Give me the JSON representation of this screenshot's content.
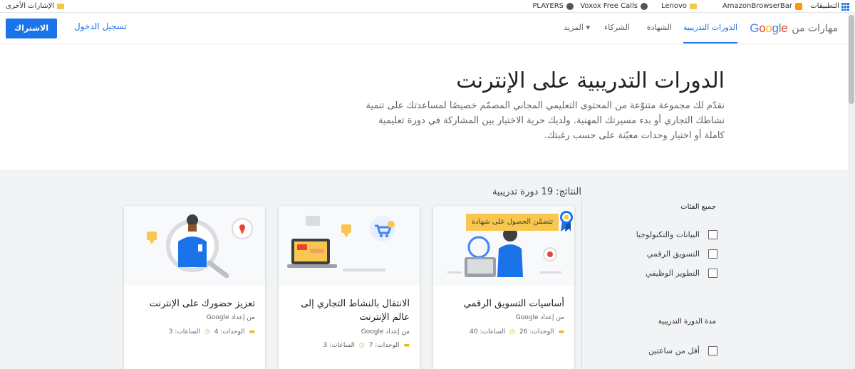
{
  "bookmarks": {
    "left": [
      {
        "label": "الإشارات الأخرى",
        "icon": "folder-icon"
      }
    ],
    "right": [
      {
        "label": "التطبيقات",
        "icon": "apps-icon"
      },
      {
        "label": "AmazonBrowserBar",
        "icon": "amazon-icon"
      },
      {
        "label": "Lenovo",
        "icon": "folder-icon"
      },
      {
        "label": "Voxox Free Calls",
        "icon": "globe-icon"
      },
      {
        "label": "PLAYERS",
        "icon": "globe-icon"
      }
    ]
  },
  "header": {
    "brand_text": "مهارات من",
    "google": "Google",
    "nav": [
      {
        "label": "الدورات التدريبية",
        "active": true
      },
      {
        "label": "الشهادة",
        "active": false
      },
      {
        "label": "الشركاء",
        "active": false
      },
      {
        "label": "المزيد ▾",
        "active": false
      }
    ],
    "signin": "تسجيل الدخول",
    "subscribe": "الاشتراك"
  },
  "hero": {
    "title": "الدورات التدريبية على الإنترنت",
    "description": "نقدّم لك مجموعة متنوّعة من المحتوى التعليمي المجاني المصمّم خصيصًا لمساعدتك على تنمية نشاطك التجاري أو بدء مسيرتك المهنية. ولديك حرية الاختيار بين المشاركة في دورة تعليمية كاملة أو اختيار وحدات معيّنة على حسب رغبتك."
  },
  "results": {
    "label": "النتائج: 19 دورة تدريبية"
  },
  "filters": {
    "categories_heading": "جميع الفئات",
    "categories": [
      "البيانات والتكنولوجيا",
      "التسويق الرقمي",
      "التطوير الوظيفي"
    ],
    "duration_heading": "مدة الدورة التدريبية",
    "durations": [
      "أقل من ساعتين"
    ]
  },
  "cards": [
    {
      "title": "أساسيات التسويق الرقمي",
      "author": "من إعداد Google",
      "units": "الوحدات: 26",
      "hours": "الساعات: 40",
      "badge": "تتضمّن الحصول على شهادة"
    },
    {
      "title": "الانتقال بالنشاط التجاري إلى عالم الإنترنت",
      "author": "من إعداد Google",
      "units": "الوحدات: 7",
      "hours": "الساعات: 3",
      "badge": ""
    },
    {
      "title": "تعزيز حضورك على الإنترنت",
      "author": "من إعداد Google",
      "units": "الوحدات: 4",
      "hours": "الساعات: 3",
      "badge": ""
    }
  ],
  "colors": {
    "primary": "#1a73e8",
    "badge": "#f9c74f",
    "background_gray": "#f1f3f4"
  }
}
